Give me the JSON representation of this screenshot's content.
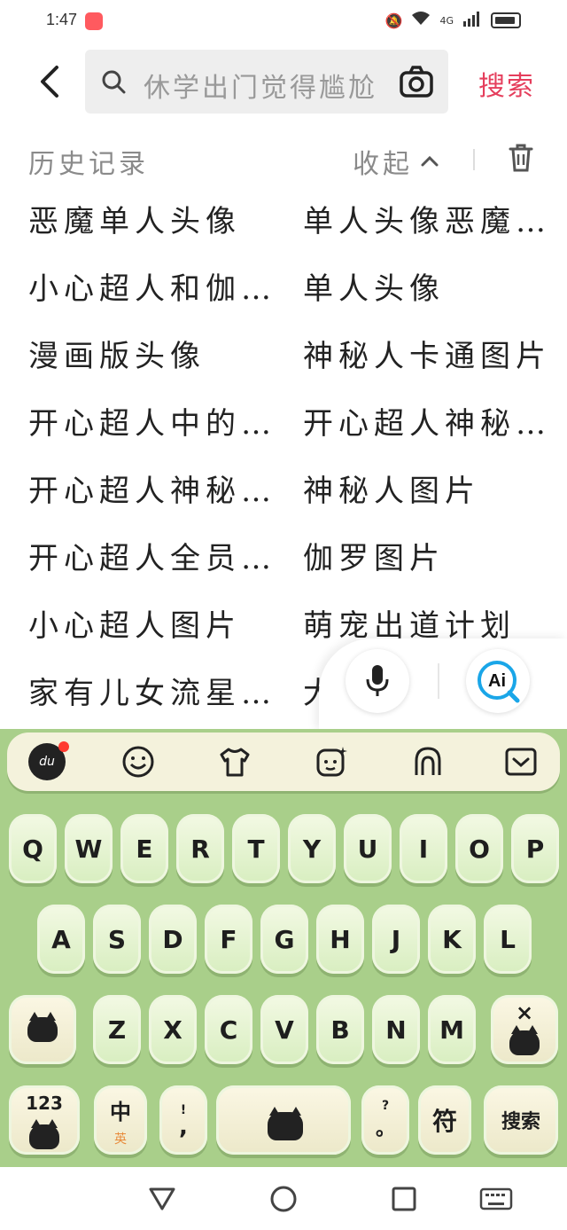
{
  "status_bar": {
    "time": "1:47",
    "network": "4G"
  },
  "search": {
    "placeholder": "休学出门觉得尴尬",
    "submit_label": "搜索"
  },
  "history": {
    "title": "历史记录",
    "collapse_label": "收起",
    "items": [
      "恶魔单人头像",
      "单人头像恶魔…",
      "小心超人和伽…",
      "单人头像",
      "漫画版头像",
      "神秘人卡通图片",
      "开心超人中的…",
      "开心超人神秘…",
      "开心超人神秘…",
      "神秘人图片",
      "开心超人全员…",
      "伽罗图片",
      "小心超人图片",
      "萌宠出道计划",
      "家有儿女流星…",
      "大"
    ]
  },
  "float_bar": {
    "ai_label": "Ai"
  },
  "keyboard": {
    "toolbar_logo": "du",
    "row1": [
      "Q",
      "W",
      "E",
      "R",
      "T",
      "Y",
      "U",
      "I",
      "O",
      "P"
    ],
    "row2": [
      "A",
      "S",
      "D",
      "F",
      "G",
      "H",
      "J",
      "K",
      "L"
    ],
    "row3": [
      "Z",
      "X",
      "C",
      "V",
      "B",
      "N",
      "M"
    ],
    "delete_label": "×",
    "num_label": "123",
    "lang_main": "中",
    "lang_sub": "英",
    "comma_top": "!",
    "comma_main": ",",
    "period_top": "?",
    "period_main": "。",
    "symbol_label": "符",
    "search_key_label": "搜索",
    "accent_colors": {
      "board": "#a9cf8a",
      "key": "#d8eec0",
      "brand_red": "#e53e5c"
    }
  }
}
